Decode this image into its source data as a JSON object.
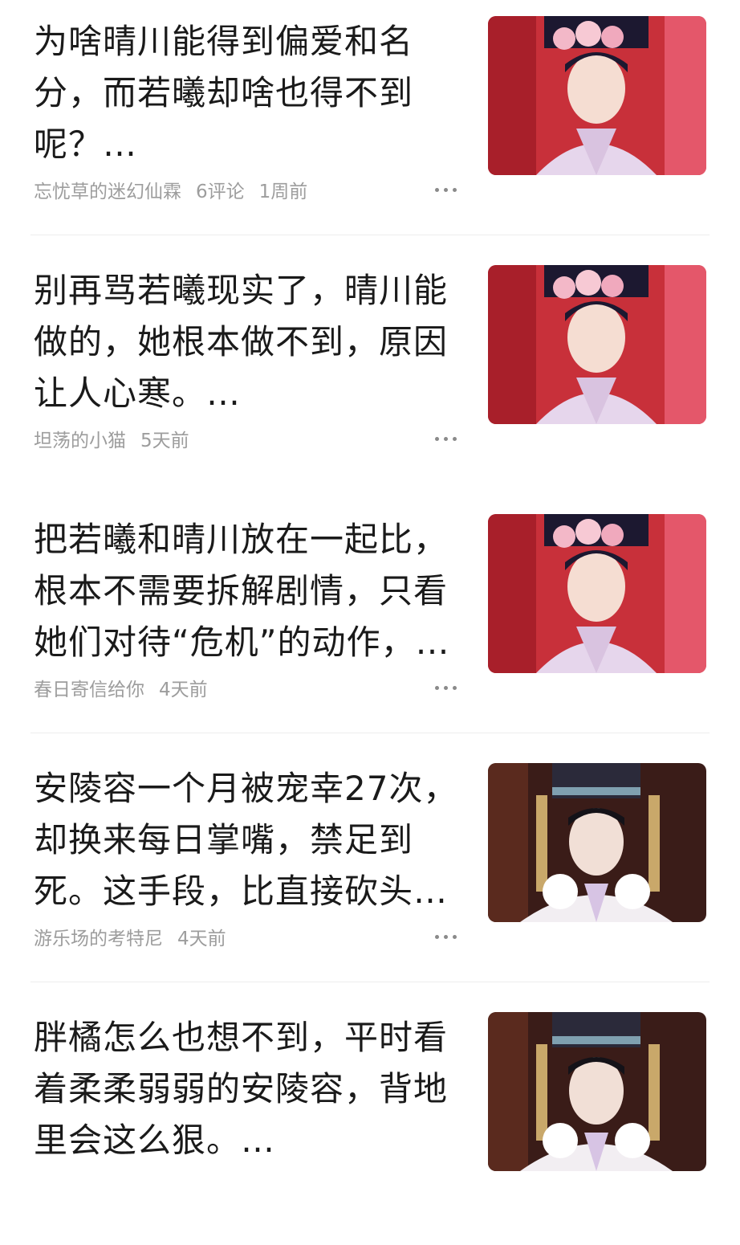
{
  "feed": {
    "items": [
      {
        "title": "为啥晴川能得到偏爱和名分，而若曦却啥也得不到呢？…",
        "author": "忘忧草的迷幻仙霖",
        "comments": "6评论",
        "time": "1周前",
        "thumb_icon": "thumbnail-image"
      },
      {
        "title": "别再骂若曦现实了，晴川能做的，她根本做不到，原因让人心寒。…",
        "author": "坦荡的小猫",
        "comments": "",
        "time": "5天前",
        "thumb_icon": "thumbnail-image"
      },
      {
        "title": "把若曦和晴川放在一起比，根本不需要拆解剧情，只看她们对待“危机”的动作，…",
        "author": "春日寄信给你",
        "comments": "",
        "time": "4天前",
        "thumb_icon": "thumbnail-image"
      },
      {
        "title": "安陵容一个月被宠幸27次，却换来每日掌嘴，禁足到死。这手段，比直接砍头还毒…",
        "author": "游乐场的考特尼",
        "comments": "",
        "time": "4天前",
        "thumb_icon": "thumbnail-image"
      },
      {
        "title": "胖橘怎么也想不到，平时看着柔柔弱弱的安陵容，背地里会这么狠。…",
        "author": "",
        "comments": "",
        "time": "",
        "thumb_icon": "thumbnail-image"
      }
    ]
  },
  "colors": {
    "title": "#1a1a1a",
    "meta": "#9d9d9d",
    "divider": "#eeeeee",
    "more_dots": "#8a8a8a"
  }
}
